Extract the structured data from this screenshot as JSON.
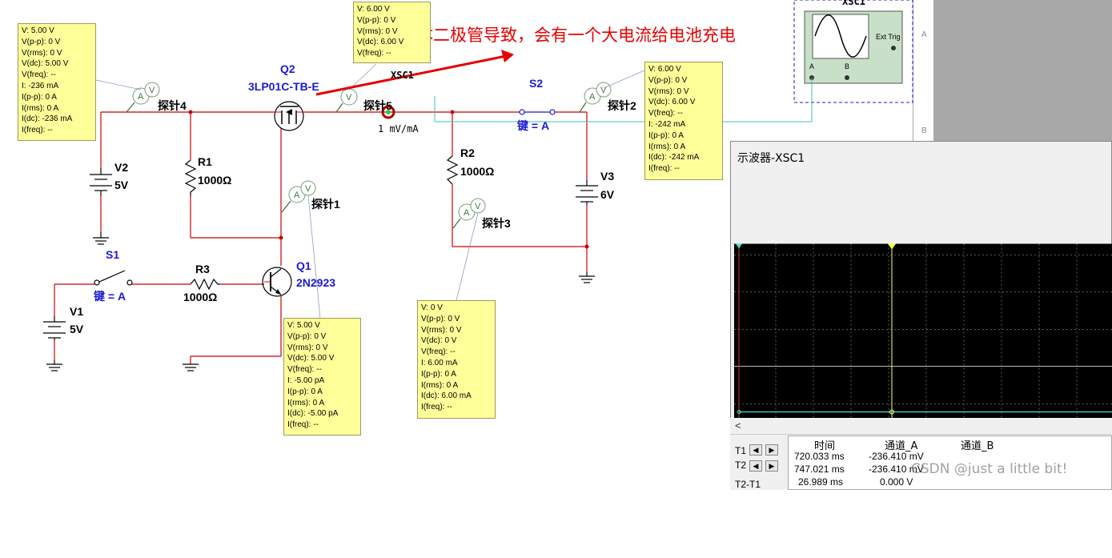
{
  "annotation": "体二极管导致，会有一个大电流给电池充电",
  "watermark": "CSDN @just a little bit!",
  "probe_setting": "1 mV/mA",
  "scope_ref": "XSC1",
  "scope_icon": {
    "ext_trig": "Ext Trig",
    "a": "A",
    "b": "B"
  },
  "ruler": {
    "a": "A",
    "b": "B"
  },
  "components": {
    "v1": {
      "name": "V1",
      "value": "5V"
    },
    "v2": {
      "name": "V2",
      "value": "5V"
    },
    "v3": {
      "name": "V3",
      "value": "6V"
    },
    "r1": {
      "name": "R1",
      "value": "1000Ω"
    },
    "r2": {
      "name": "R2",
      "value": "1000Ω"
    },
    "r3": {
      "name": "R3",
      "value": "1000Ω"
    },
    "q1": {
      "name": "Q1",
      "part": "2N2923"
    },
    "q2": {
      "name": "Q2",
      "part": "3LP01C-TB-E"
    },
    "s1": {
      "name": "S1",
      "key": "键 = A"
    },
    "s2": {
      "name": "S2",
      "key": "键 = A"
    },
    "probe1": "探针1",
    "probe2": "探针2",
    "probe3": "探针3",
    "probe4": "探针4",
    "probe5": "探针5"
  },
  "probe4_tip": [
    "V: 5.00 V",
    "V(p-p): 0 V",
    "V(rms): 0 V",
    "V(dc): 5.00 V",
    "V(freq): --",
    "I: -236 mA",
    "I(p-p): 0 A",
    "I(rms): 0 A",
    "I(dc): -236 mA",
    "I(freq): --"
  ],
  "probe5_tip": [
    "V: 6.00 V",
    "V(p-p): 0 V",
    "V(rms): 0 V",
    "V(dc): 6.00 V",
    "V(freq): --"
  ],
  "probe2_tip": [
    "V: 6.00 V",
    "V(p-p): 0 V",
    "V(rms): 0 V",
    "V(dc): 6.00 V",
    "V(freq): --",
    "I: -242 mA",
    "I(p-p): 0 A",
    "I(rms): 0 A",
    "I(dc): -242 mA",
    "I(freq): --"
  ],
  "probe3_tip": [
    "V: 0 V",
    "V(p-p): 0 V",
    "V(rms): 0 V",
    "V(dc): 0 V",
    "V(freq): --",
    "I: 6.00 mA",
    "I(p-p): 0 A",
    "I(rms): 0 A",
    "I(dc): 6.00 mA",
    "I(freq): --"
  ],
  "probe1_tip": [
    "V: 5.00 V",
    "V(p-p): 0 V",
    "V(rms): 0 V",
    "V(dc): 5.00 V",
    "V(freq): --",
    "I: -5.00 pA",
    "I(p-p): 0 A",
    "I(rms): 0 A",
    "I(dc): -5.00 pA",
    "I(freq): --"
  ],
  "oscilloscope": {
    "title": "示波器-XSC1",
    "scroll_left": "<",
    "col_time": "时间",
    "col_a": "通道_A",
    "col_b": "通道_B",
    "rows": [
      {
        "label": "T1",
        "time": "720.033 ms",
        "a": "-236.410 mV",
        "b": ""
      },
      {
        "label": "T2",
        "time": "747.021 ms",
        "a": "-236.410 mV",
        "b": ""
      },
      {
        "label": "T2-T1",
        "time": "26.989 ms",
        "a": "0.000 V",
        "b": ""
      }
    ],
    "colors": {
      "background": "#000000",
      "trace": "#40e0d0",
      "cursor": "#ffff66",
      "grid": "#808080"
    }
  }
}
